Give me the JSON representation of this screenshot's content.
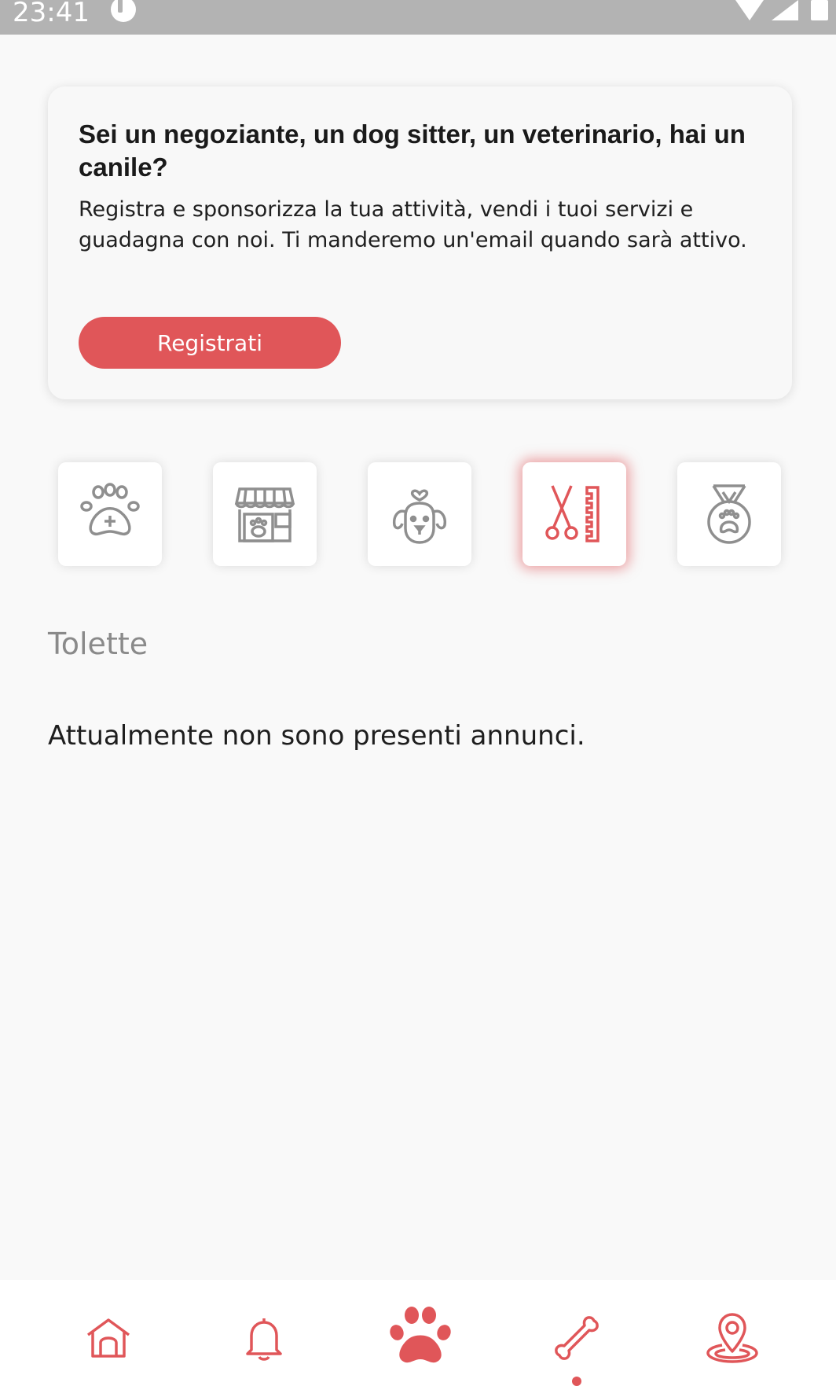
{
  "status_bar": {
    "time": "23:41"
  },
  "promo": {
    "title": "Sei un negoziante, un dog sitter, un veterinario, hai un canile?",
    "text": "Registra e sponsorizza la tua attività, vendi i tuoi servizi e guadagna con noi. Ti manderemo un'email quando sarà attivo.",
    "button_label": "Registrati"
  },
  "categories": [
    {
      "icon": "paw-plus-icon",
      "selected": false
    },
    {
      "icon": "pet-shop-icon",
      "selected": false
    },
    {
      "icon": "dog-heart-icon",
      "selected": false
    },
    {
      "icon": "grooming-scissors-comb-icon",
      "selected": true
    },
    {
      "icon": "dog-medal-icon",
      "selected": false
    }
  ],
  "section": {
    "title": "Tolette",
    "empty_message": "Attualmente non sono presenti annunci."
  },
  "bottom_nav": [
    {
      "icon": "dog-house-icon"
    },
    {
      "icon": "bell-icon"
    },
    {
      "icon": "paw-icon"
    },
    {
      "icon": "bone-icon",
      "active": true
    },
    {
      "icon": "map-pin-icon"
    }
  ],
  "colors": {
    "accent": "#e05659",
    "icon_gray": "#8f8f8f",
    "background": "#f9f9f9",
    "status_bar": "#b3b3b3"
  }
}
